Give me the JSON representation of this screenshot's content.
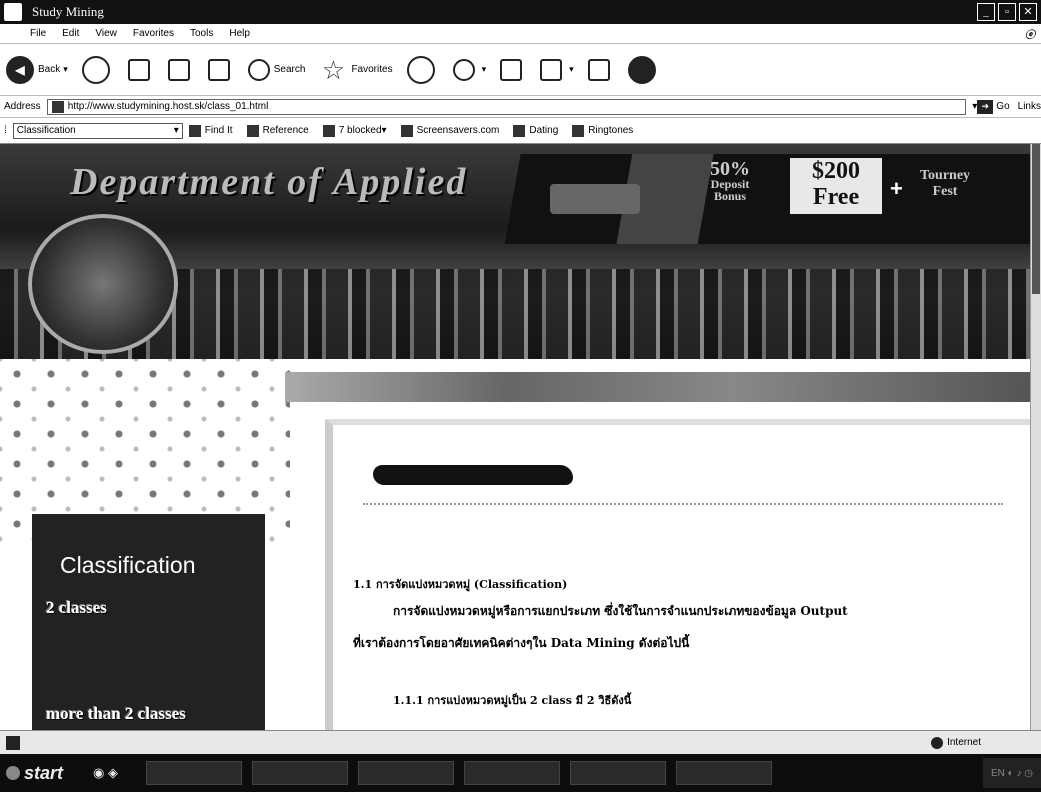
{
  "window": {
    "title": "Study Mining"
  },
  "menu": [
    "File",
    "Edit",
    "View",
    "Favorites",
    "Tools",
    "Help"
  ],
  "toolbar": {
    "back": "Back",
    "search": "Search",
    "favorites": "Favorites"
  },
  "address": {
    "label": "Address",
    "url": "http://www.studymining.host.sk/class_01.html",
    "go": "Go",
    "links": "Links"
  },
  "linksbar": {
    "combo": "Classification",
    "find": "Find It",
    "reference": "Reference",
    "blocked": "7 blocked",
    "screensavers": "Screensavers.com",
    "dating": "Dating",
    "ringtones": "Ringtones"
  },
  "banner": {
    "dept": "Department of Applied",
    "ad": {
      "pct": "50%",
      "deposit": "Deposit",
      "bonus": "Bonus",
      "amount": "$200",
      "free": "Free",
      "plus": "+",
      "tourney": "Tourney",
      "fest": "Fest"
    }
  },
  "ticker": {
    "text": ""
  },
  "sidemenu": {
    "title": "Classification",
    "item1": "2 classes",
    "item2": "more than 2 classes"
  },
  "content": {
    "heading": "1.1 การจัดแบ่งหมวดหมู่ (Classification)",
    "para1": "การจัดแบ่งหมวดหมู่หรือการแยกประเภท ซึ่งใช้ในการจำแนกประเภทของข้อมูล Output",
    "para2": "ที่เราต้องการโดยอาศัยเทคนิคต่างๆใน Data Mining ดังต่อไปนี้",
    "sub": "1.1.1 การแบ่งหมวดหมู่เป็น 2 class มี 2 วิธีดังนี้"
  },
  "status": {
    "zone": "Internet"
  },
  "taskbar": {
    "start": "start"
  }
}
